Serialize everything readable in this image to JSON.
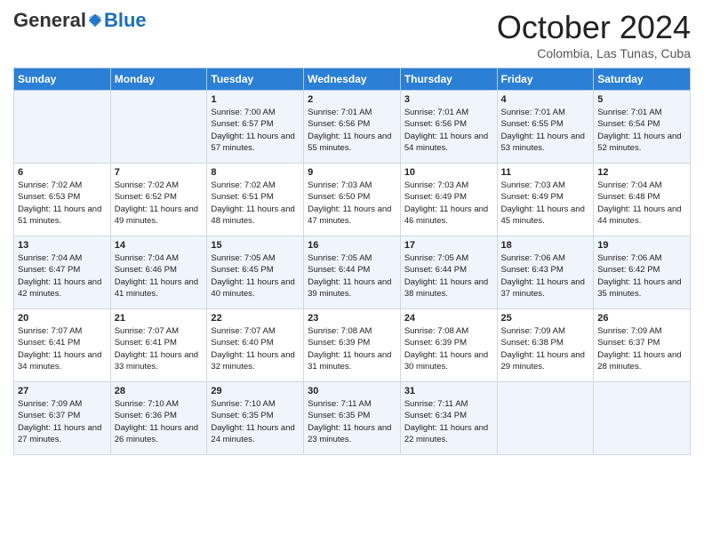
{
  "logo": {
    "general": "General",
    "blue": "Blue"
  },
  "header": {
    "month": "October 2024",
    "location": "Colombia, Las Tunas, Cuba"
  },
  "days_of_week": [
    "Sunday",
    "Monday",
    "Tuesday",
    "Wednesday",
    "Thursday",
    "Friday",
    "Saturday"
  ],
  "weeks": [
    [
      {
        "day": "",
        "sunrise": "",
        "sunset": "",
        "daylight": ""
      },
      {
        "day": "",
        "sunrise": "",
        "sunset": "",
        "daylight": ""
      },
      {
        "day": "1",
        "sunrise": "Sunrise: 7:00 AM",
        "sunset": "Sunset: 6:57 PM",
        "daylight": "Daylight: 11 hours and 57 minutes."
      },
      {
        "day": "2",
        "sunrise": "Sunrise: 7:01 AM",
        "sunset": "Sunset: 6:56 PM",
        "daylight": "Daylight: 11 hours and 55 minutes."
      },
      {
        "day": "3",
        "sunrise": "Sunrise: 7:01 AM",
        "sunset": "Sunset: 6:56 PM",
        "daylight": "Daylight: 11 hours and 54 minutes."
      },
      {
        "day": "4",
        "sunrise": "Sunrise: 7:01 AM",
        "sunset": "Sunset: 6:55 PM",
        "daylight": "Daylight: 11 hours and 53 minutes."
      },
      {
        "day": "5",
        "sunrise": "Sunrise: 7:01 AM",
        "sunset": "Sunset: 6:54 PM",
        "daylight": "Daylight: 11 hours and 52 minutes."
      }
    ],
    [
      {
        "day": "6",
        "sunrise": "Sunrise: 7:02 AM",
        "sunset": "Sunset: 6:53 PM",
        "daylight": "Daylight: 11 hours and 51 minutes."
      },
      {
        "day": "7",
        "sunrise": "Sunrise: 7:02 AM",
        "sunset": "Sunset: 6:52 PM",
        "daylight": "Daylight: 11 hours and 49 minutes."
      },
      {
        "day": "8",
        "sunrise": "Sunrise: 7:02 AM",
        "sunset": "Sunset: 6:51 PM",
        "daylight": "Daylight: 11 hours and 48 minutes."
      },
      {
        "day": "9",
        "sunrise": "Sunrise: 7:03 AM",
        "sunset": "Sunset: 6:50 PM",
        "daylight": "Daylight: 11 hours and 47 minutes."
      },
      {
        "day": "10",
        "sunrise": "Sunrise: 7:03 AM",
        "sunset": "Sunset: 6:49 PM",
        "daylight": "Daylight: 11 hours and 46 minutes."
      },
      {
        "day": "11",
        "sunrise": "Sunrise: 7:03 AM",
        "sunset": "Sunset: 6:49 PM",
        "daylight": "Daylight: 11 hours and 45 minutes."
      },
      {
        "day": "12",
        "sunrise": "Sunrise: 7:04 AM",
        "sunset": "Sunset: 6:48 PM",
        "daylight": "Daylight: 11 hours and 44 minutes."
      }
    ],
    [
      {
        "day": "13",
        "sunrise": "Sunrise: 7:04 AM",
        "sunset": "Sunset: 6:47 PM",
        "daylight": "Daylight: 11 hours and 42 minutes."
      },
      {
        "day": "14",
        "sunrise": "Sunrise: 7:04 AM",
        "sunset": "Sunset: 6:46 PM",
        "daylight": "Daylight: 11 hours and 41 minutes."
      },
      {
        "day": "15",
        "sunrise": "Sunrise: 7:05 AM",
        "sunset": "Sunset: 6:45 PM",
        "daylight": "Daylight: 11 hours and 40 minutes."
      },
      {
        "day": "16",
        "sunrise": "Sunrise: 7:05 AM",
        "sunset": "Sunset: 6:44 PM",
        "daylight": "Daylight: 11 hours and 39 minutes."
      },
      {
        "day": "17",
        "sunrise": "Sunrise: 7:05 AM",
        "sunset": "Sunset: 6:44 PM",
        "daylight": "Daylight: 11 hours and 38 minutes."
      },
      {
        "day": "18",
        "sunrise": "Sunrise: 7:06 AM",
        "sunset": "Sunset: 6:43 PM",
        "daylight": "Daylight: 11 hours and 37 minutes."
      },
      {
        "day": "19",
        "sunrise": "Sunrise: 7:06 AM",
        "sunset": "Sunset: 6:42 PM",
        "daylight": "Daylight: 11 hours and 35 minutes."
      }
    ],
    [
      {
        "day": "20",
        "sunrise": "Sunrise: 7:07 AM",
        "sunset": "Sunset: 6:41 PM",
        "daylight": "Daylight: 11 hours and 34 minutes."
      },
      {
        "day": "21",
        "sunrise": "Sunrise: 7:07 AM",
        "sunset": "Sunset: 6:41 PM",
        "daylight": "Daylight: 11 hours and 33 minutes."
      },
      {
        "day": "22",
        "sunrise": "Sunrise: 7:07 AM",
        "sunset": "Sunset: 6:40 PM",
        "daylight": "Daylight: 11 hours and 32 minutes."
      },
      {
        "day": "23",
        "sunrise": "Sunrise: 7:08 AM",
        "sunset": "Sunset: 6:39 PM",
        "daylight": "Daylight: 11 hours and 31 minutes."
      },
      {
        "day": "24",
        "sunrise": "Sunrise: 7:08 AM",
        "sunset": "Sunset: 6:39 PM",
        "daylight": "Daylight: 11 hours and 30 minutes."
      },
      {
        "day": "25",
        "sunrise": "Sunrise: 7:09 AM",
        "sunset": "Sunset: 6:38 PM",
        "daylight": "Daylight: 11 hours and 29 minutes."
      },
      {
        "day": "26",
        "sunrise": "Sunrise: 7:09 AM",
        "sunset": "Sunset: 6:37 PM",
        "daylight": "Daylight: 11 hours and 28 minutes."
      }
    ],
    [
      {
        "day": "27",
        "sunrise": "Sunrise: 7:09 AM",
        "sunset": "Sunset: 6:37 PM",
        "daylight": "Daylight: 11 hours and 27 minutes."
      },
      {
        "day": "28",
        "sunrise": "Sunrise: 7:10 AM",
        "sunset": "Sunset: 6:36 PM",
        "daylight": "Daylight: 11 hours and 26 minutes."
      },
      {
        "day": "29",
        "sunrise": "Sunrise: 7:10 AM",
        "sunset": "Sunset: 6:35 PM",
        "daylight": "Daylight: 11 hours and 24 minutes."
      },
      {
        "day": "30",
        "sunrise": "Sunrise: 7:11 AM",
        "sunset": "Sunset: 6:35 PM",
        "daylight": "Daylight: 11 hours and 23 minutes."
      },
      {
        "day": "31",
        "sunrise": "Sunrise: 7:11 AM",
        "sunset": "Sunset: 6:34 PM",
        "daylight": "Daylight: 11 hours and 22 minutes."
      },
      {
        "day": "",
        "sunrise": "",
        "sunset": "",
        "daylight": ""
      },
      {
        "day": "",
        "sunrise": "",
        "sunset": "",
        "daylight": ""
      }
    ]
  ]
}
